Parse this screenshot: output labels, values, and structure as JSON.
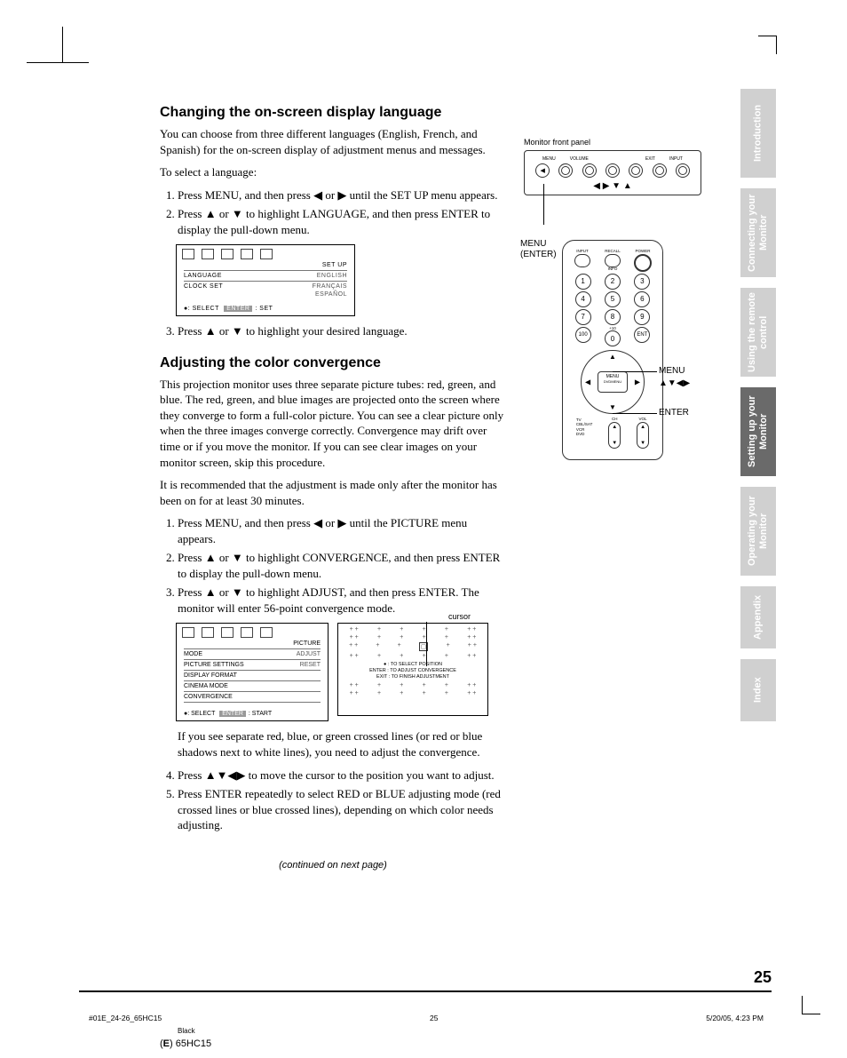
{
  "section1": {
    "heading": "Changing the on-screen display language",
    "para1": "You can choose from three different languages (English, French, and Spanish) for the on-screen display of adjustment menus and messages.",
    "lead": "To select a language:",
    "step1": "Press MENU, and then press ◀ or ▶ until the SET UP menu appears.",
    "step2": "Press ▲ or ▼ to highlight LANGUAGE, and then press ENTER to display the pull-down menu.",
    "step3": "Press ▲ or ▼ to highlight your desired language."
  },
  "osd1": {
    "title": "SET UP",
    "row1_label": "LANGUAGE",
    "row1_val": "ENGLISH",
    "row2_label": "CLOCK SET",
    "row2_val1": "FRANÇAIS",
    "row2_val2": "ESPAÑOL",
    "foot_select": ": SELECT",
    "foot_enter": "ENTER",
    "foot_set": ": SET"
  },
  "section2": {
    "heading": "Adjusting the color convergence",
    "para1": "This projection monitor uses three separate picture tubes: red, green, and blue. The red, green, and blue images are projected onto the screen where they converge to form a full-color picture. You can see a clear picture only when the three images converge correctly. Convergence may drift over time or if you move the monitor. If you can see clear images on your monitor screen, skip this procedure.",
    "para2": "It is recommended that the adjustment is made only after the monitor has been on for at least 30 minutes.",
    "step1": "Press MENU, and then press ◀ or ▶ until the PICTURE menu appears.",
    "step2": "Press ▲ or ▼ to highlight CONVERGENCE, and then press ENTER to display the pull-down menu.",
    "step3": "Press ▲ or ▼ to highlight ADJUST, and then press ENTER. The monitor will enter 56-point convergence mode.",
    "after1": "If you see separate red, blue, or green crossed lines (or red or blue shadows next to white lines), you need to adjust the convergence.",
    "step4": "Press ▲▼◀▶ to move the cursor to the position you want to adjust.",
    "step5": "Press ENTER repeatedly to select RED or BLUE adjusting mode (red crossed lines or blue crossed lines), depending on which color needs adjusting."
  },
  "osd2": {
    "title": "PICTURE",
    "rows": [
      "MODE",
      "PICTURE SETTINGS",
      "DISPLAY FORMAT",
      "CINEMA MODE",
      "CONVERGENCE"
    ],
    "vals": [
      "ADJUST",
      "RESET"
    ],
    "foot_select": ": SELECT",
    "foot_enter": "ENTER",
    "foot_start": ": START"
  },
  "cursor_label": "cursor",
  "grid_text_line1": "● : TO SELECT POSITION",
  "grid_text_line2": "ENTER : TO ADJUST CONVERGENCE",
  "grid_text_line3": "EXIT : TO FINISH ADJUSTMENT",
  "panel": {
    "label": "Monitor front panel",
    "top": [
      "MENU",
      "VOLUME",
      "",
      "",
      "",
      "EXIT",
      "INPUT"
    ],
    "menu_label": "MENU",
    "enter_label": "(ENTER)",
    "arrows": "◀ ▶ ▼ ▲"
  },
  "remote": {
    "top_labels": [
      "INPUT",
      "RECALL",
      "POWER"
    ],
    "info_label": "INFO",
    "nums": [
      "1",
      "2",
      "3",
      "4",
      "5",
      "6",
      "7",
      "8",
      "9",
      "100",
      "0",
      "ENT"
    ],
    "plus10": "+10",
    "dpad_center1": "MENU",
    "dpad_center2": "DVDMENU",
    "callout_menu": "MENU",
    "callout_arrows": "▲▼◀▶",
    "callout_enter": "ENTER",
    "bot_tv": "TV\nCBL/SAT\nVCR\nDVD",
    "bot_ch": "CH",
    "bot_vol": "VOL"
  },
  "tabs": [
    {
      "label": "Introduction",
      "active": false
    },
    {
      "label": "Connecting your Monitor",
      "active": false
    },
    {
      "label": "Using the remote control",
      "active": false
    },
    {
      "label": "Setting up your Monitor",
      "active": true
    },
    {
      "label": "Operating your Monitor",
      "active": false
    },
    {
      "label": "Appendix",
      "active": false
    },
    {
      "label": "Index",
      "active": false
    }
  ],
  "continued": "(continued on next page)",
  "page_number": "25",
  "footer": {
    "file": "#01E_24-26_65HC15",
    "pg": "25",
    "date": "5/20/05, 4:23 PM",
    "black": "Black",
    "model_prefix": "(E) ",
    "model": "65HC15"
  }
}
